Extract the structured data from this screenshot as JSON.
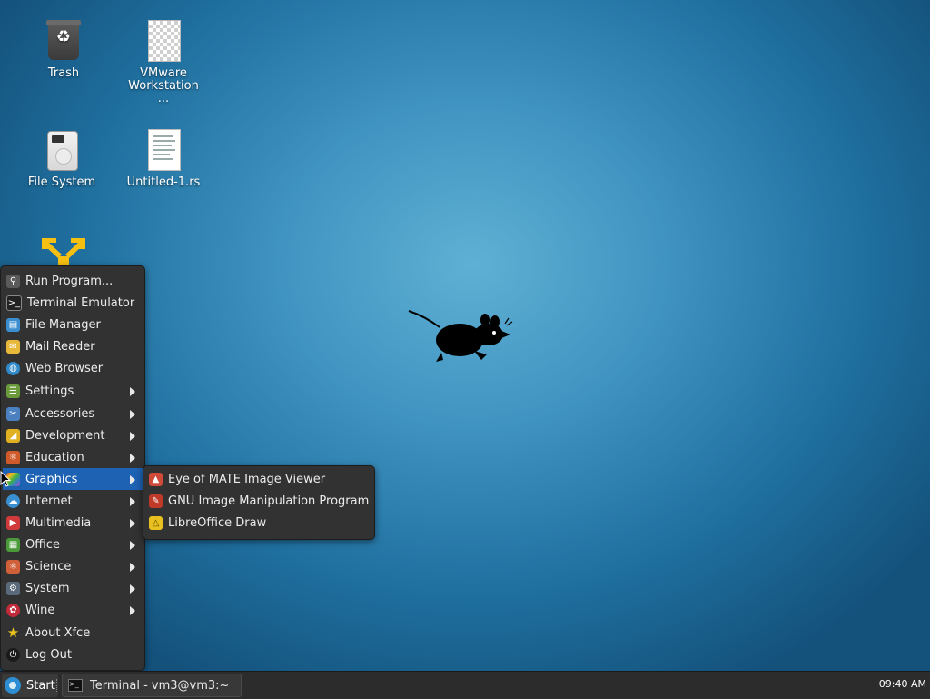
{
  "desktop": {
    "icons": [
      {
        "id": "trash",
        "label": "Trash"
      },
      {
        "id": "vmware",
        "label": "VMware Workstation ..."
      },
      {
        "id": "filesystem",
        "label": "File System"
      },
      {
        "id": "untitled",
        "label": "Untitled-1.rs"
      }
    ]
  },
  "menu": {
    "items": [
      {
        "label": "Run Program...",
        "icon": "run-icon",
        "color": "#5a5a5a"
      },
      {
        "label": "Terminal Emulator",
        "icon": "terminal-icon",
        "color": "#222222"
      },
      {
        "label": "File Manager",
        "icon": "file-manager-icon",
        "color": "#3b8fd0"
      },
      {
        "label": "Mail Reader",
        "icon": "mail-icon",
        "color": "#e8b83a"
      },
      {
        "label": "Web Browser",
        "icon": "globe-icon",
        "color": "#2f89c9"
      },
      {
        "label": "Settings",
        "icon": "settings-icon",
        "color": "#6a9a3a"
      },
      {
        "label": "Accessories",
        "icon": "accessories-icon",
        "color": "#4a7fc0"
      },
      {
        "label": "Development",
        "icon": "development-icon",
        "color": "#e0b020"
      },
      {
        "label": "Education",
        "icon": "education-icon",
        "color": "#d05a2a"
      },
      {
        "label": "Graphics",
        "icon": "graphics-icon",
        "color": "#c84ab0"
      },
      {
        "label": "Internet",
        "icon": "internet-icon",
        "color": "#3a8fd0"
      },
      {
        "label": "Multimedia",
        "icon": "multimedia-icon",
        "color": "#d03a3a"
      },
      {
        "label": "Office",
        "icon": "office-icon",
        "color": "#4a9a3a"
      },
      {
        "label": "Science",
        "icon": "science-icon",
        "color": "#d0603a"
      },
      {
        "label": "System",
        "icon": "system-icon",
        "color": "#5a6a7a"
      },
      {
        "label": "Wine",
        "icon": "wine-icon",
        "color": "#c02a3a"
      },
      {
        "label": "About Xfce",
        "icon": "star-icon",
        "color": "#e8c020"
      },
      {
        "label": "Log Out",
        "icon": "logout-icon",
        "color": "#3a3a3a"
      }
    ],
    "active": "Graphics"
  },
  "graphics_submenu": {
    "items": [
      {
        "label": "Eye of MATE Image Viewer",
        "icon": "image-viewer-icon",
        "color": "#d04a3a"
      },
      {
        "label": "GNU Image Manipulation Program",
        "icon": "gimp-icon",
        "color": "#c03a2a"
      },
      {
        "label": "LibreOffice Draw",
        "icon": "libreoffice-draw-icon",
        "color": "#e8c020"
      }
    ]
  },
  "taskbar": {
    "start_label": "Start",
    "task_label": "Terminal - vm3@vm3:~",
    "clock": "09:40 AM"
  },
  "colors": {
    "menu_bg": "#323232",
    "menu_active": "#1e62b4",
    "taskbar_bg": "#2c2c2c"
  }
}
